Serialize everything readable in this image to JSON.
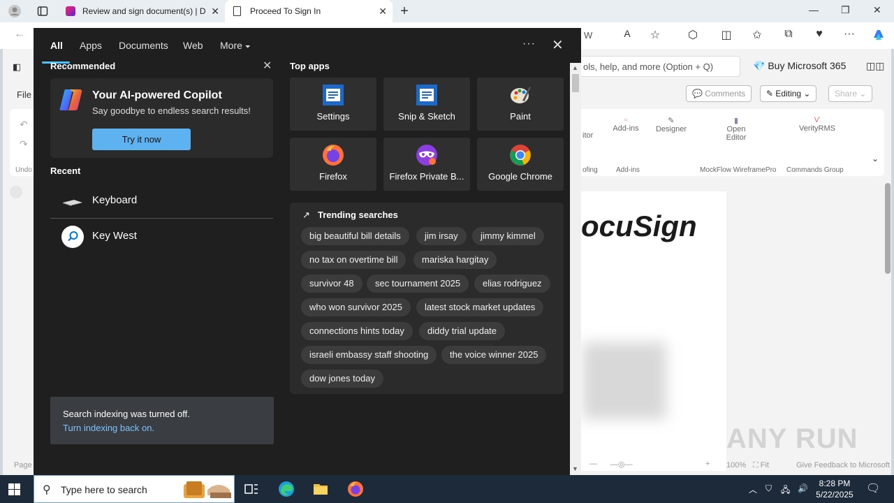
{
  "browser": {
    "tabs": [
      {
        "title": "Review and sign document(s) | D"
      },
      {
        "title": "Proceed To Sign In"
      }
    ],
    "new_tab_symbol": "+",
    "address_fragment": "W",
    "icons": [
      "profile-icon",
      "tab-actions-icon",
      "read-aloud-icon",
      "favorite-star-icon",
      "extensions-icon",
      "split-screen-icon",
      "favorites-icon",
      "collections-icon",
      "performance-icon",
      "more-icon",
      "copilot-icon"
    ]
  },
  "word": {
    "search_placeholder": "ols, help, and more (Option + Q)",
    "buy_label": "Buy Microsoft 365",
    "file_label": "File",
    "comments_label": "Comments",
    "editing_label": "Editing",
    "share_label": "Share",
    "ribbon_items": [
      "itor",
      "Add-ins",
      "Designer",
      "Open Editor",
      "VerityRMS"
    ],
    "ribbon_groups": [
      "ofing",
      "Add-ins",
      "MockFlow WireframePro",
      "Commands Group"
    ],
    "undo_label": "Undo",
    "docusign_text": "ocuSign",
    "status_page": "Page",
    "status_zoom": "100%",
    "status_fit": "Fit",
    "status_feedback": "Give Feedback to Microsoft"
  },
  "search_panel": {
    "nav": {
      "tabs": [
        "All",
        "Apps",
        "Documents",
        "Web",
        "More"
      ],
      "active": "All",
      "more_symbol": "⏷",
      "dots": "···",
      "close": "✕"
    },
    "recommended": {
      "title": "Recommended",
      "card_title": "Your AI-powered Copilot",
      "card_subtitle": "Say goodbye to endless search results!",
      "button": "Try it now"
    },
    "recent": {
      "title": "Recent",
      "items": [
        "Keyboard",
        "Key West"
      ]
    },
    "top_apps": {
      "title": "Top apps",
      "apps": [
        "Settings",
        "Snip & Sketch",
        "Paint",
        "Firefox",
        "Firefox Private B...",
        "Google Chrome"
      ]
    },
    "trending": {
      "title": "Trending searches",
      "chips": [
        "big beautiful bill details",
        "jim irsay",
        "jimmy kimmel",
        "no tax on overtime bill",
        "mariska hargitay",
        "survivor 48",
        "sec tournament 2025",
        "elias rodriguez",
        "who won survivor 2025",
        "latest stock market updates",
        "connections hints today",
        "diddy trial update",
        "israeli embassy staff shooting",
        "the voice winner 2025",
        "dow jones today"
      ]
    },
    "notice": {
      "line1": "Search indexing was turned off.",
      "line2": "Turn indexing back on."
    }
  },
  "taskbar": {
    "search_placeholder": "Type here to search",
    "time": "8:28 PM",
    "date": "5/22/2025"
  },
  "watermark": "ANY RUN",
  "colors": {
    "panel_bg": "#1f1f1f",
    "accent_blue": "#4cc2ff",
    "try_button": "#5fb2f0",
    "taskbar_bg": "#1c2a3a"
  }
}
